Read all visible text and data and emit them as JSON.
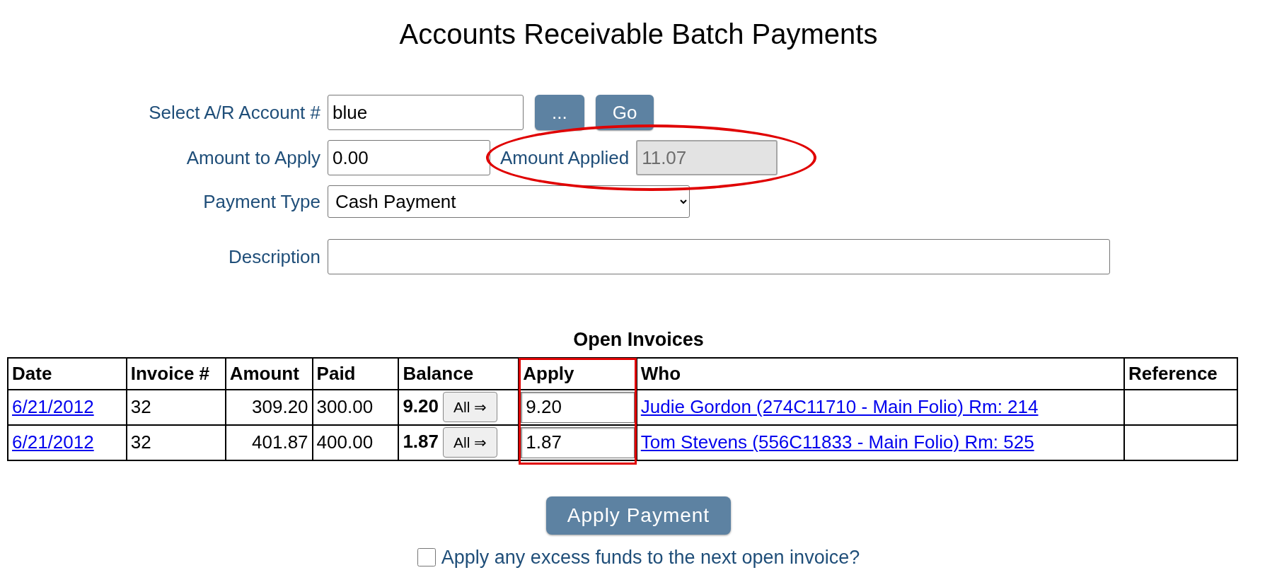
{
  "title": "Accounts Receivable Batch Payments",
  "form": {
    "account": {
      "label": "Select A/R Account #",
      "value": "blue",
      "lookup_button": "...",
      "go_button": "Go"
    },
    "amount_to_apply": {
      "label": "Amount to Apply",
      "value": "0.00"
    },
    "amount_applied": {
      "label": "Amount Applied",
      "value": "11.07",
      "disabled": true
    },
    "payment_type": {
      "label": "Payment Type",
      "value": "Cash Payment"
    },
    "description": {
      "label": "Description"
    }
  },
  "table": {
    "caption": "Open Invoices",
    "columns": [
      "Date",
      "Invoice #",
      "Amount",
      "Paid",
      "Balance",
      "Apply",
      "Who",
      "Reference"
    ],
    "rows": [
      {
        "date": "6/21/2012",
        "invoice": "32",
        "amount": "309.20",
        "paid": "300.00",
        "balance": "9.20",
        "all_button": "All ⇒",
        "apply": "9.20",
        "who": "Judie Gordon (274C11710 - Main Folio) Rm: 214"
      },
      {
        "date": "6/21/2012",
        "invoice": "32",
        "amount": "401.87",
        "paid": "400.00",
        "balance": "1.87",
        "all_button": "All ⇒",
        "apply": "1.87",
        "who": "Tom Stevens (556C11833 - Main Folio) Rm: 525"
      }
    ]
  },
  "apply_button": "Apply Payment",
  "excess_checkbox": {
    "label": "Apply any excess funds to the next open invoice?",
    "checked": false
  },
  "annotations": [
    {
      "kind": "ellipse"
    },
    {
      "kind": "rectangle"
    }
  ]
}
